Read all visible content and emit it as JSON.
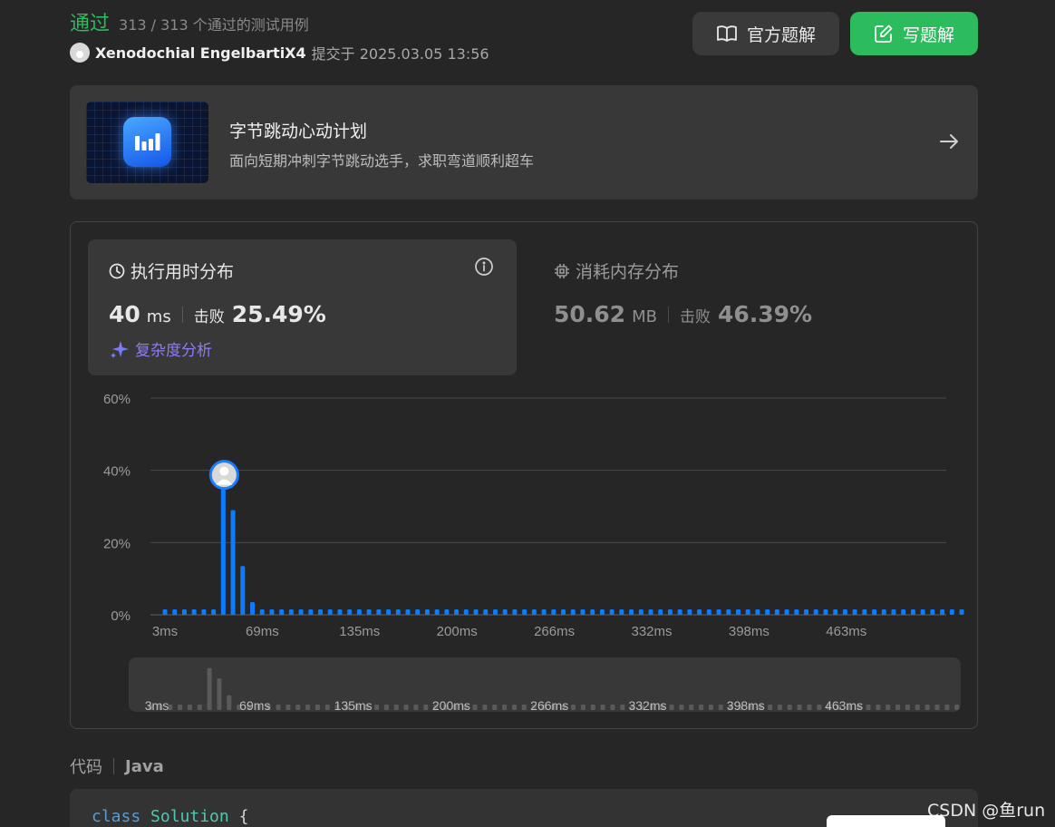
{
  "status": {
    "result": "通过",
    "cases": "313 / 313 个通过的测试用例"
  },
  "submission": {
    "user": "Xenodochial EngelbartiX4",
    "submitted_at": "提交于 2025.03.05 13:56"
  },
  "buttons": {
    "official": "官方题解",
    "write": "写题解"
  },
  "banner": {
    "title": "字节跳动心动计划",
    "subtitle": "面向短期冲刺字节跳动选手，求职弯道顺利超车"
  },
  "runtime": {
    "title": "执行用时分布",
    "value": "40",
    "unit": "ms",
    "beat_label": "击败",
    "beat_pct": "25.49%",
    "complexity_link": "复杂度分析"
  },
  "memory": {
    "title": "消耗内存分布",
    "value": "50.62",
    "unit": "MB",
    "beat_label": "击败",
    "beat_pct": "46.39%"
  },
  "chart_data": {
    "type": "bar",
    "ylabel": "",
    "xlabel": "",
    "ylim": [
      0,
      60
    ],
    "y_ticks": [
      "0%",
      "20%",
      "40%",
      "60%"
    ],
    "x_ticks": [
      "3ms",
      "69ms",
      "135ms",
      "200ms",
      "266ms",
      "332ms",
      "398ms",
      "463ms"
    ],
    "values": [
      1.5,
      1.5,
      1.5,
      1.5,
      1.5,
      1.5,
      38.5,
      29,
      13.5,
      3.5,
      1.5,
      1.5,
      1.5,
      1.5,
      1.5,
      1.5,
      1.5,
      1.5,
      1.5,
      1.5,
      1.5,
      1.5,
      1.5,
      1.5,
      1.5,
      1.5,
      1.5,
      1.5,
      1.5,
      1.5,
      1.5,
      1.5,
      1.5,
      1.5,
      1.5,
      1.5,
      1.5,
      1.5,
      1.5,
      1.5,
      1.5,
      1.5,
      1.5,
      1.5,
      1.5,
      1.5,
      1.5,
      1.5,
      1.5,
      1.5,
      1.5,
      1.5,
      1.5,
      1.5,
      1.5,
      1.5,
      1.5,
      1.5,
      1.5,
      1.5,
      1.5,
      1.5,
      1.5,
      1.5,
      1.5,
      1.5,
      1.5,
      1.5,
      1.5,
      1.5,
      1.5,
      1.5,
      1.5,
      1.5,
      1.5,
      1.5,
      1.5,
      1.5,
      1.5,
      1.5,
      1.5,
      1.5,
      1.5
    ],
    "highlight_index": 6,
    "bar_color": "#0a7cff",
    "mini_color": "#5a5a5a",
    "grid": true
  },
  "code": {
    "label": "代码",
    "language": "Java",
    "first_line": {
      "keyword": "class",
      "classname": "Solution",
      "brace": "{"
    }
  },
  "watermark": "CSDN @鱼run",
  "colors": {
    "accent_green": "#2cbb5d",
    "bar_blue": "#0a7cff",
    "purple_link": "#8d7cf5"
  }
}
